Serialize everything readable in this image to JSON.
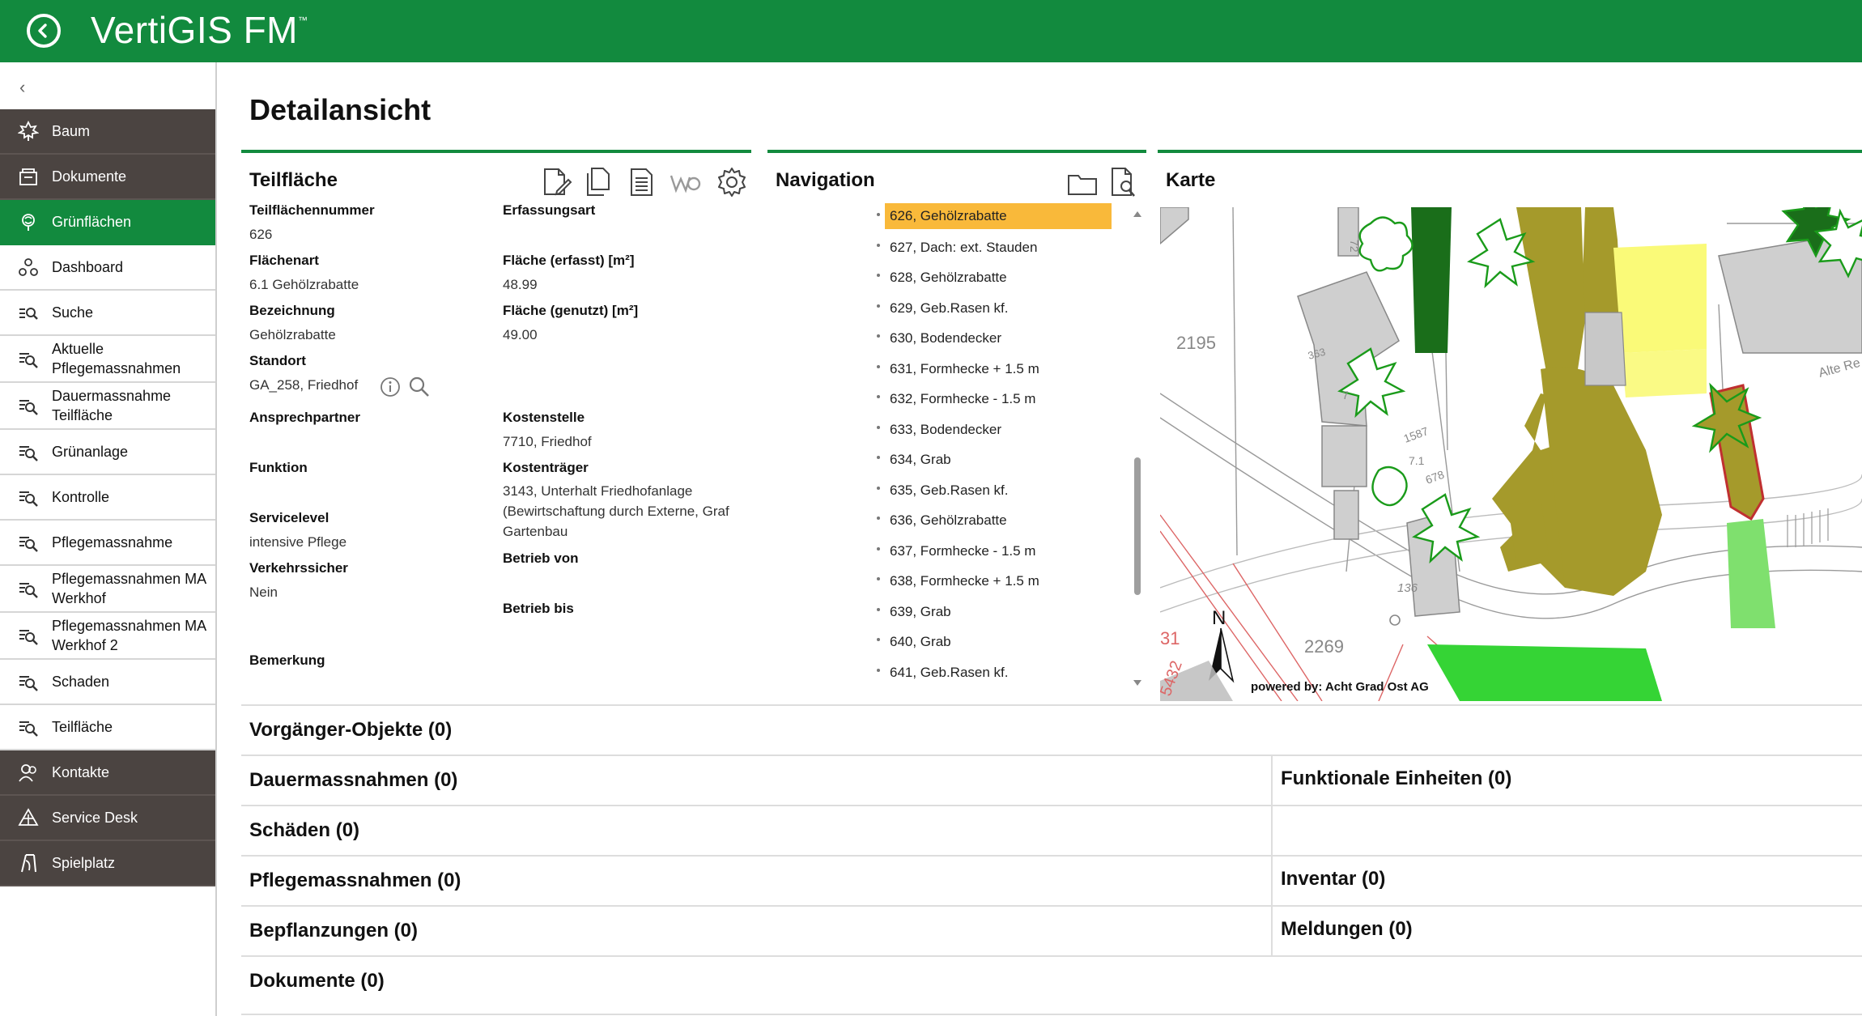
{
  "app": {
    "brand": "VertiGIS FM",
    "trademark": "™"
  },
  "sidebar": {
    "collapse_glyph": "‹",
    "items": [
      {
        "label": "Baum",
        "icon": "tree-icon",
        "style": "dark"
      },
      {
        "label": "Dokumente",
        "icon": "document-stack-icon",
        "style": "dark"
      },
      {
        "label": "Grünflächen",
        "icon": "greenspace-icon",
        "style": "active"
      },
      {
        "label": "Dashboard",
        "icon": "dashboard-icon",
        "style": "light"
      },
      {
        "label": "Suche",
        "icon": "search-list-icon",
        "style": "light"
      },
      {
        "label": "Aktuelle Pflegemassnahmen",
        "icon": "list-search-icon",
        "style": "light"
      },
      {
        "label": "Dauermassnahme Teilfläche",
        "icon": "list-search-icon",
        "style": "light"
      },
      {
        "label": "Grünanlage",
        "icon": "list-search-icon",
        "style": "light"
      },
      {
        "label": "Kontrolle",
        "icon": "list-search-icon",
        "style": "light"
      },
      {
        "label": "Pflegemassnahme",
        "icon": "list-search-icon",
        "style": "light"
      },
      {
        "label": "Pflegemassnahmen MA Werkhof",
        "icon": "list-search-icon",
        "style": "light"
      },
      {
        "label": "Pflegemassnahmen MA Werkhof 2",
        "icon": "list-search-icon",
        "style": "light"
      },
      {
        "label": "Schaden",
        "icon": "list-search-icon",
        "style": "light"
      },
      {
        "label": "Teilfläche",
        "icon": "list-search-icon",
        "style": "light"
      },
      {
        "label": "Kontakte",
        "icon": "contacts-icon",
        "style": "dark"
      },
      {
        "label": "Service Desk",
        "icon": "service-desk-icon",
        "style": "dark"
      },
      {
        "label": "Spielplatz",
        "icon": "playground-icon",
        "style": "dark"
      }
    ]
  },
  "page": {
    "title": "Detailansicht"
  },
  "teilflaeche": {
    "title": "Teilfläche",
    "fields_left": [
      {
        "label": "Teilflächennummer",
        "value": "626"
      },
      {
        "label": "Flächenart",
        "value": "6.1 Gehölzrabatte"
      },
      {
        "label": "Bezeichnung",
        "value": "Gehölzrabatte"
      },
      {
        "label": "Standort",
        "value": "GA_258, Friedhof"
      },
      {
        "label": "Ansprechpartner",
        "value": ""
      },
      {
        "label": "Funktion",
        "value": ""
      },
      {
        "label": "Servicelevel",
        "value": "intensive Pflege"
      },
      {
        "label": "Verkehrssicher",
        "value": "Nein"
      },
      {
        "label": "Bemerkung",
        "value": ""
      }
    ],
    "fields_right": [
      {
        "label": "Erfassungsart",
        "value": ""
      },
      {
        "label": "Fläche (erfasst) [m²]",
        "value": "48.99"
      },
      {
        "label": "Fläche (genutzt) [m²]",
        "value": "49.00"
      },
      {
        "label": "Kostenstelle",
        "value": "7710, Friedhof"
      },
      {
        "label": "Kostenträger",
        "value": "3143, Unterhalt Friedhofanlage (Bewirtschaftung durch Externe, Graf Gartenbau"
      },
      {
        "label": "Betrieb von",
        "value": ""
      },
      {
        "label": "Betrieb bis",
        "value": ""
      }
    ]
  },
  "navigation": {
    "title": "Navigation",
    "items": [
      "626, Gehölzrabatte",
      "627, Dach: ext. Stauden",
      "628, Gehölzrabatte",
      "629, Geb.Rasen kf.",
      "630, Bodendecker",
      "631, Formhecke + 1.5 m",
      "632, Formhecke - 1.5 m",
      "633, Bodendecker",
      "634, Grab",
      "635, Geb.Rasen kf.",
      "636, Gehölzrabatte",
      "637, Formhecke - 1.5 m",
      "638, Formhecke + 1.5 m",
      "639, Grab",
      "640, Grab",
      "641, Geb.Rasen kf."
    ],
    "selected_index": 0
  },
  "karte": {
    "title": "Karte",
    "labels": {
      "parcel_a": "2195",
      "parcel_b": "2269",
      "parcel_c": "31",
      "parcel_d": "5432",
      "house_a": "363",
      "house_b": "7",
      "house_c": "1587",
      "house_d": "7.1",
      "house_e": "678",
      "house_f": "72",
      "road": "136",
      "street": "Alte Re",
      "north": "N",
      "credit": "powered by: Acht Grad Ost AG"
    },
    "colors": {
      "olive": "#a59a2b",
      "yellow": "#fafa78",
      "light_green": "#7fe06e",
      "dark_green": "#1a6e1a",
      "bright_green": "#35d435"
    }
  },
  "sections": {
    "vorgaenger": "Vorgänger-Objekte (0)",
    "dauermassnahmen": "Dauermassnahmen (0)",
    "funktionale": "Funktionale Einheiten (0)",
    "schaeden": "Schäden (0)",
    "pflegemassnahmen": "Pflegemassnahmen (0)",
    "inventar": "Inventar (0)",
    "bepflanzungen": "Bepflanzungen (0)",
    "meldungen": "Meldungen (0)",
    "dokumente": "Dokumente (0)"
  },
  "colors": {
    "brand_green": "#128a3e",
    "sidebar_dark": "#4b4441",
    "selection": "#f9b93a"
  }
}
